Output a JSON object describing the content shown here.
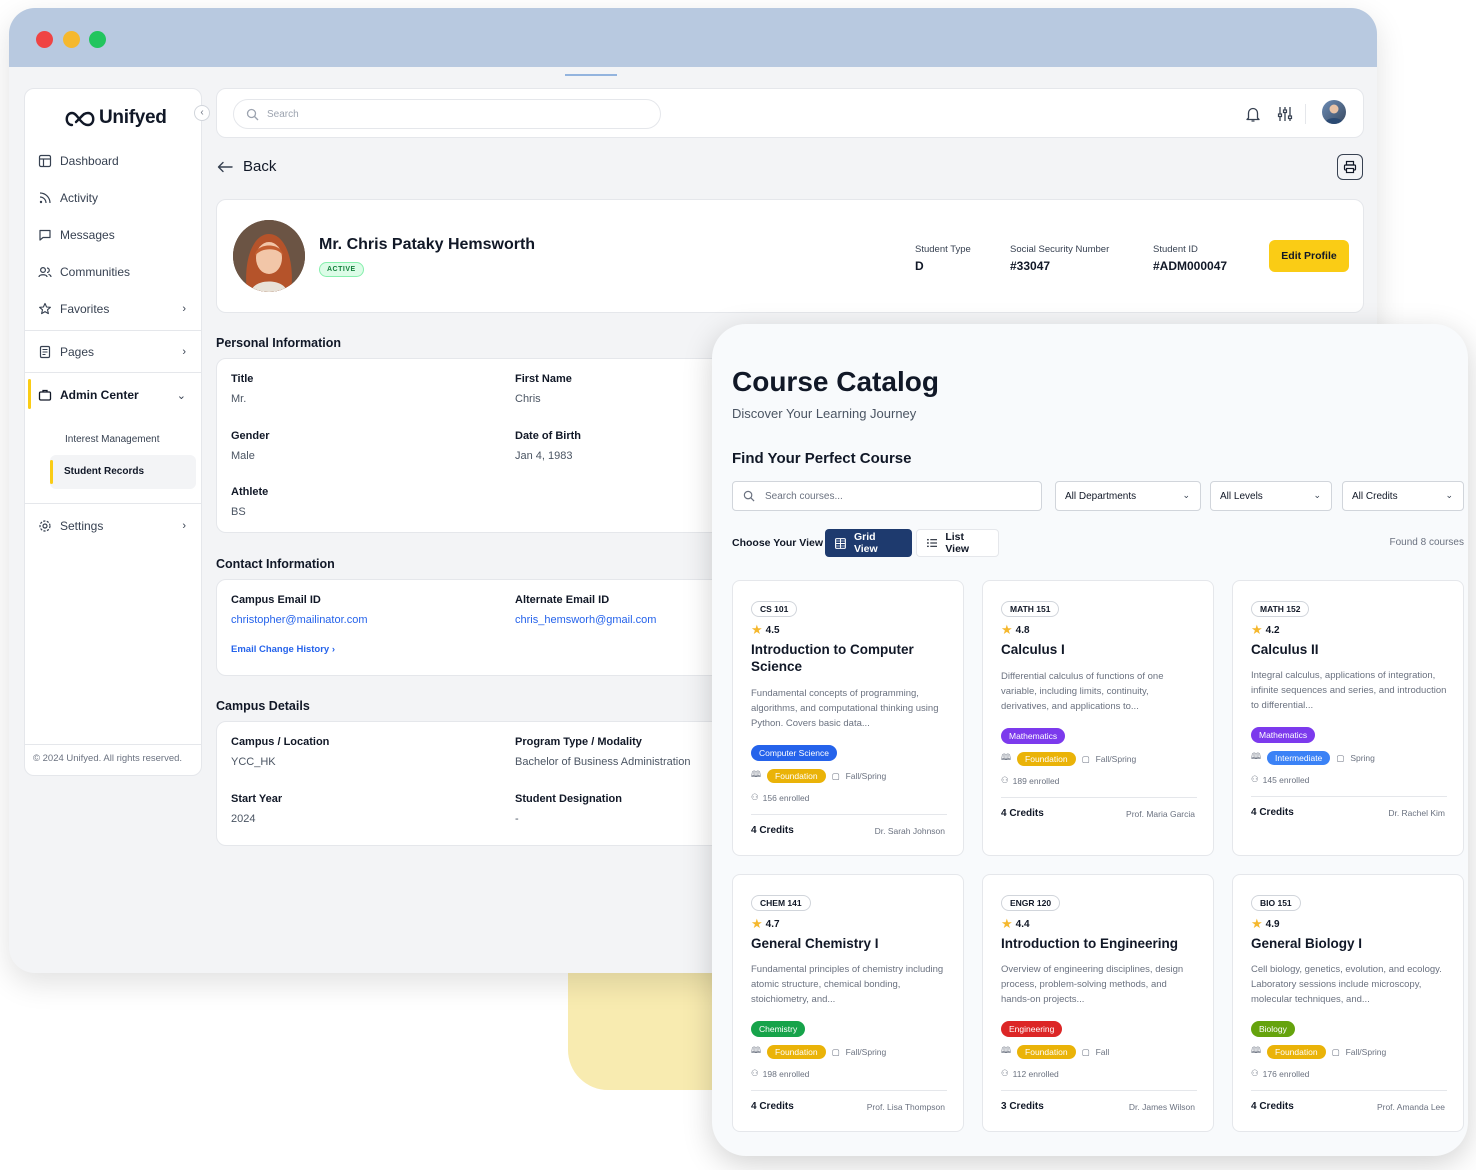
{
  "sidebar": {
    "logo": "Unifyed",
    "items": [
      {
        "label": "Dashboard",
        "icon": "dashboard-icon"
      },
      {
        "label": "Activity",
        "icon": "rss-icon"
      },
      {
        "label": "Messages",
        "icon": "message-icon"
      },
      {
        "label": "Communities",
        "icon": "users-icon"
      },
      {
        "label": "Favorites",
        "icon": "star-icon"
      },
      {
        "label": "Pages",
        "icon": "pages-icon"
      },
      {
        "label": "Admin Center",
        "icon": "briefcase-icon"
      },
      {
        "label": "Settings",
        "icon": "gear-icon"
      }
    ],
    "sub_items": [
      "Interest Management",
      "Student Records"
    ],
    "copyright": "© 2024 Unifyed. All rights reserved."
  },
  "topbar": {
    "search_placeholder": "Search"
  },
  "back_label": "Back",
  "profile": {
    "name": "Mr. Chris Pataky Hemsworth",
    "status": "ACTIVE",
    "fields": [
      {
        "label": "Student Type",
        "value": "D"
      },
      {
        "label": "Social Security Number",
        "value": "#33047"
      },
      {
        "label": "Student ID",
        "value": "#ADM000047"
      }
    ],
    "edit_label": "Edit Profile"
  },
  "personal": {
    "title": "Personal Information",
    "fields": [
      {
        "label": "Title",
        "value": "Mr."
      },
      {
        "label": "First Name",
        "value": "Chris"
      },
      {
        "label": "Gender",
        "value": "Male"
      },
      {
        "label": "Date of Birth",
        "value": "Jan 4, 1983"
      },
      {
        "label": "Athlete",
        "value": "BS"
      }
    ]
  },
  "contact": {
    "title": "Contact Information",
    "fields": [
      {
        "label": "Campus Email ID",
        "value": "christopher@mailinator.com"
      },
      {
        "label": "Alternate Email ID",
        "value": "chris_hemsworh@gmail.com"
      }
    ],
    "history_link": "Email Change History"
  },
  "campus": {
    "title": "Campus Details",
    "fields": [
      {
        "label": "Campus / Location",
        "value": "YCC_HK"
      },
      {
        "label": "Program Type / Modality",
        "value": "Bachelor of Business Administration"
      },
      {
        "label": "Start Year",
        "value": "2024"
      },
      {
        "label": "Student Designation",
        "value": "-"
      }
    ]
  },
  "catalog": {
    "title": "Course Catalog",
    "subtitle": "Discover Your Learning Journey",
    "find_title": "Find Your Perfect Course",
    "search_placeholder": "Search courses...",
    "filters": [
      "All Departments",
      "All Levels",
      "All Credits"
    ],
    "view_label": "Choose Your View",
    "grid_label": "Grid View",
    "list_label": "List View",
    "found": "Found 8 courses",
    "courses": [
      {
        "code": "CS 101",
        "rating": "4.5",
        "title": "Introduction to Computer Science",
        "desc": "Fundamental concepts of programming, algorithms, and computational thinking using Python. Covers basic data...",
        "dept": "Computer Science",
        "dept_color": "#2563eb",
        "level": "Foundation",
        "level_color": "#eab308",
        "term": "Fall/Spring",
        "enrolled": "156 enrolled",
        "credits": "4 Credits",
        "prof": "Dr. Sarah Johnson"
      },
      {
        "code": "MATH 151",
        "rating": "4.8",
        "title": "Calculus I",
        "desc": "Differential calculus of functions of one variable, including limits, continuity, derivatives, and applications to...",
        "dept": "Mathematics",
        "dept_color": "#7c3aed",
        "level": "Foundation",
        "level_color": "#eab308",
        "term": "Fall/Spring",
        "enrolled": "189 enrolled",
        "credits": "4 Credits",
        "prof": "Prof. Maria Garcia"
      },
      {
        "code": "MATH 152",
        "rating": "4.2",
        "title": "Calculus II",
        "desc": "Integral calculus, applications of integration, infinite sequences and series, and introduction to differential...",
        "dept": "Mathematics",
        "dept_color": "#7c3aed",
        "level": "Intermediate",
        "level_color": "#3b82f6",
        "term": "Spring",
        "enrolled": "145 enrolled",
        "credits": "4 Credits",
        "prof": "Dr. Rachel Kim"
      },
      {
        "code": "CHEM 141",
        "rating": "4.7",
        "title": "General Chemistry I",
        "desc": "Fundamental principles of chemistry including atomic structure, chemical bonding, stoichiometry, and...",
        "dept": "Chemistry",
        "dept_color": "#16a34a",
        "level": "Foundation",
        "level_color": "#eab308",
        "term": "Fall/Spring",
        "enrolled": "198 enrolled",
        "credits": "4 Credits",
        "prof": "Prof. Lisa Thompson"
      },
      {
        "code": "ENGR 120",
        "rating": "4.4",
        "title": "Introduction to Engineering",
        "desc": "Overview of engineering disciplines, design process, problem-solving methods, and hands-on projects...",
        "dept": "Engineering",
        "dept_color": "#dc2626",
        "level": "Foundation",
        "level_color": "#eab308",
        "term": "Fall",
        "enrolled": "112 enrolled",
        "credits": "3 Credits",
        "prof": "Dr. James Wilson"
      },
      {
        "code": "BIO 151",
        "rating": "4.9",
        "title": "General Biology I",
        "desc": "Cell biology, genetics, evolution, and ecology. Laboratory sessions include microscopy, molecular techniques, and...",
        "dept": "Biology",
        "dept_color": "#65a30d",
        "level": "Foundation",
        "level_color": "#eab308",
        "term": "Fall/Spring",
        "enrolled": "176 enrolled",
        "credits": "4 Credits",
        "prof": "Prof. Amanda Lee"
      }
    ]
  }
}
